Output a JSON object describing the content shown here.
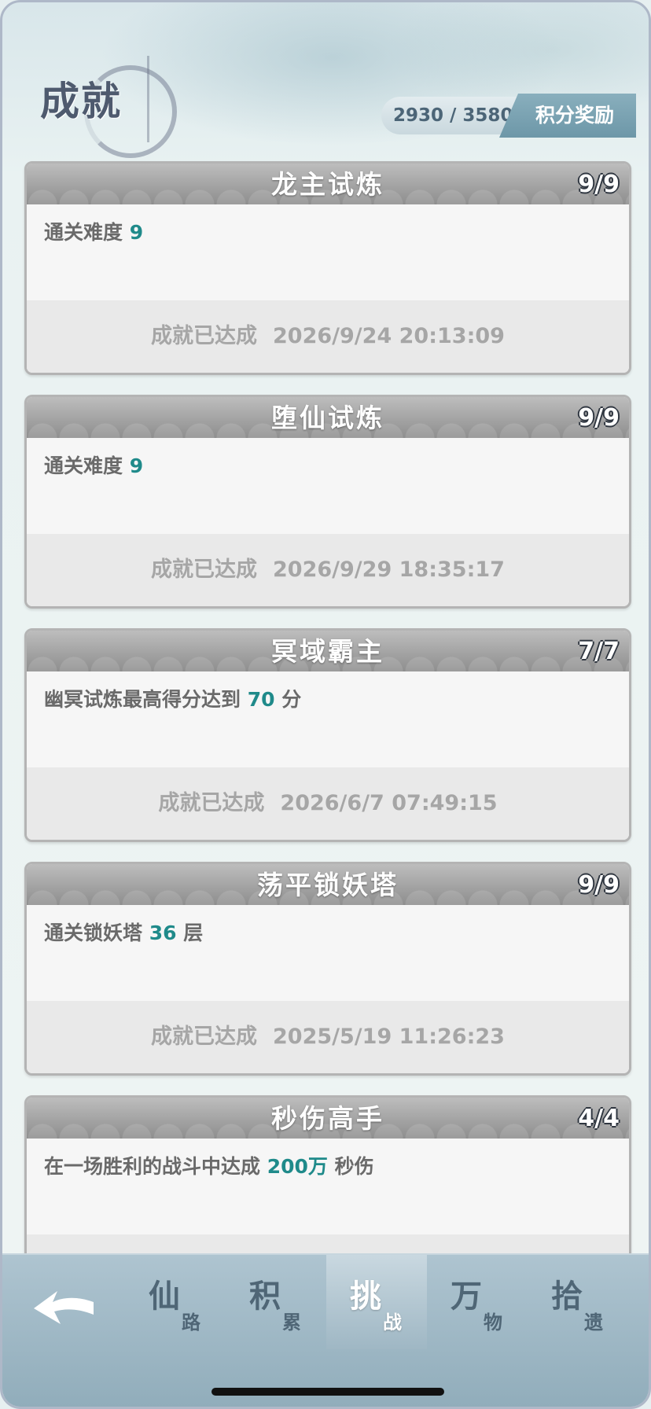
{
  "header": {
    "title": "成就",
    "score": "2930 / 3580",
    "reward_label": "积分奖励"
  },
  "achievements": [
    {
      "title": "龙主试炼",
      "count": "9/9",
      "desc_pre": "通关难度 ",
      "desc_hl": "9",
      "desc_post": "",
      "status": "成就已达成",
      "time": "2026/9/24 20:13:09"
    },
    {
      "title": "堕仙试炼",
      "count": "9/9",
      "desc_pre": "通关难度 ",
      "desc_hl": "9",
      "desc_post": "",
      "status": "成就已达成",
      "time": "2026/9/29 18:35:17"
    },
    {
      "title": "冥域霸主",
      "count": "7/7",
      "desc_pre": "幽冥试炼最高得分达到 ",
      "desc_hl": "70",
      "desc_post": " 分",
      "status": "成就已达成",
      "time": "2026/6/7 07:49:15"
    },
    {
      "title": "荡平锁妖塔",
      "count": "9/9",
      "desc_pre": "通关锁妖塔 ",
      "desc_hl": "36",
      "desc_post": " 层",
      "status": "成就已达成",
      "time": "2025/5/19 11:26:23"
    },
    {
      "title": "秒伤高手",
      "count": "4/4",
      "desc_pre": "在一场胜利的战斗中达成 ",
      "desc_hl": "200万",
      "desc_post": " 秒伤",
      "status": "",
      "time": ""
    }
  ],
  "nav": {
    "back_icon": "back-arrow-icon",
    "tabs": [
      {
        "big": "仙",
        "small": "路",
        "active": false
      },
      {
        "big": "积",
        "small": "累",
        "active": false
      },
      {
        "big": "挑",
        "small": "战",
        "active": true
      },
      {
        "big": "万",
        "small": "物",
        "active": false
      },
      {
        "big": "拾",
        "small": "遗",
        "active": false
      }
    ]
  },
  "colors": {
    "highlight": "#1f8a8a",
    "card_header": "#9e9e9e",
    "nav_bg": "#a1b9c6"
  }
}
